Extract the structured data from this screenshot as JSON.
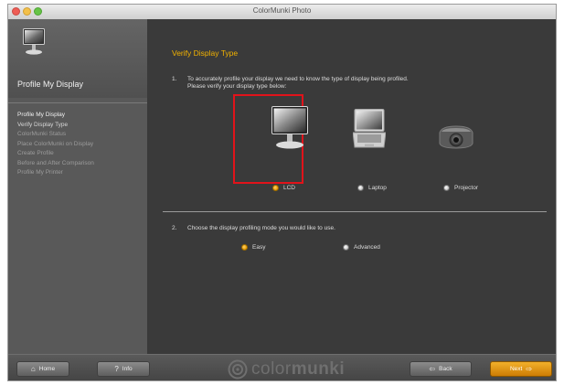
{
  "window": {
    "title": "ColorMunki Photo"
  },
  "sidebar": {
    "header_title": "Profile My Display",
    "steps": [
      "Profile My Display",
      "Verify Display Type",
      "ColorMunki Status",
      "Place ColorMunki on Display",
      "Create Profile",
      "Before and After Comparison",
      "Profile My Printer"
    ]
  },
  "main": {
    "title": "Verify Display Type",
    "q1_num": "1.",
    "q1_line1": "To accurately profile your display we need to know the type of display being profiled.",
    "q1_line2": "Please verify your display type below:",
    "display_types": [
      {
        "label": "LCD",
        "selected": true
      },
      {
        "label": "Laptop",
        "selected": false
      },
      {
        "label": "Projector",
        "selected": false
      }
    ],
    "q2_num": "2.",
    "q2_text": "Choose the display profiling mode you would like to use.",
    "modes": [
      {
        "label": "Easy",
        "selected": true
      },
      {
        "label": "Advanced",
        "selected": false
      }
    ]
  },
  "footer": {
    "home_label": "Home",
    "info_label": "Info",
    "brand_part1": "color",
    "brand_part2": "munki",
    "back_label": "Back",
    "next_label": "Next"
  },
  "colors": {
    "accent": "#f2b200",
    "highlight_border": "#e1131a",
    "background": "#3a3a3a",
    "sidebar": "#595959"
  }
}
